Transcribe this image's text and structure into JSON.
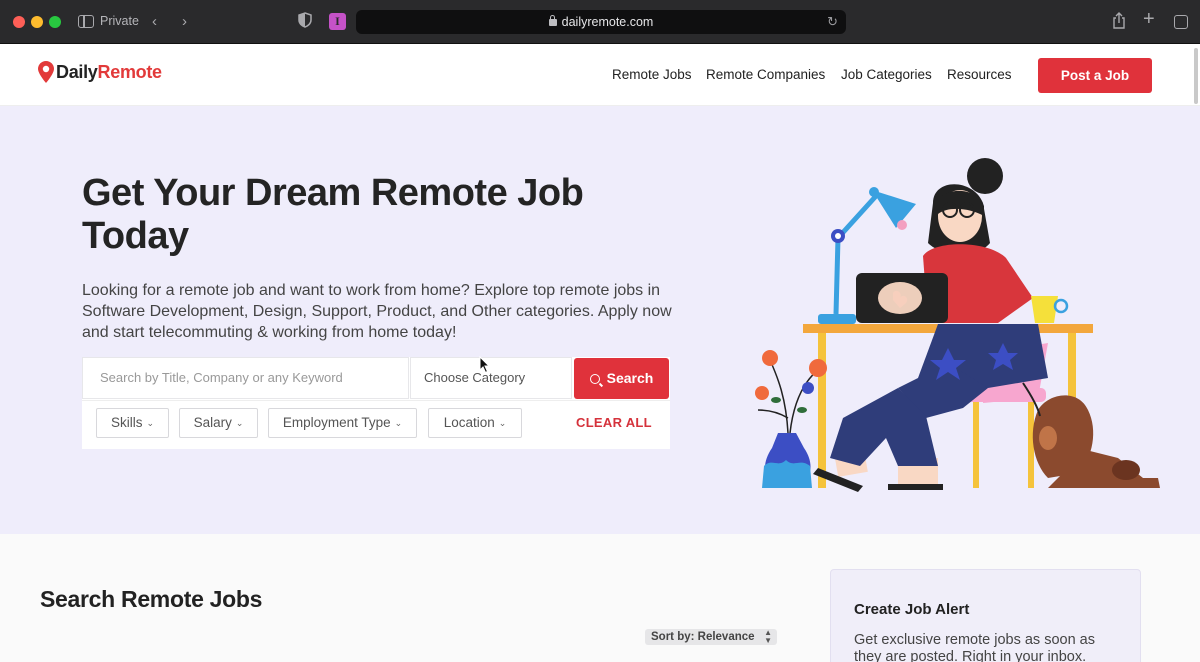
{
  "browser": {
    "private_label": "Private",
    "url": "dailyremote.com",
    "icons": [
      "sidebar-icon",
      "chevron-left-icon",
      "chevron-right-icon",
      "shield-icon",
      "extension-icon",
      "lock-icon",
      "reload-icon",
      "share-icon",
      "plus-icon",
      "tabs-icon"
    ]
  },
  "header": {
    "logo_daily": "Daily",
    "logo_remote": "Remote",
    "nav": [
      "Remote Jobs",
      "Remote Companies",
      "Job Categories",
      "Resources"
    ],
    "post_button": "Post a Job"
  },
  "hero": {
    "title": "Get Your Dream Remote Job Today",
    "description": "Looking for a remote job and want to work from home? Explore top remote jobs in Software Development, Design, Support, Product, and Other categories. Apply now and start telecommuting & working from home today!",
    "search": {
      "placeholder": "Search by Title, Company or any Keyword",
      "category_label": "Choose Category",
      "button_label": "Search"
    },
    "filters": [
      "Skills",
      "Salary",
      "Employment Type",
      "Location"
    ],
    "clear_all": "CLEAR ALL"
  },
  "jobs": {
    "section_title": "Search Remote Jobs",
    "sort_label": "Sort by: Relevance"
  },
  "alert": {
    "title": "Create Job Alert",
    "description": "Get exclusive remote jobs as soon as they are posted. Right in your inbox."
  },
  "colors": {
    "brand_red": "#e0323b",
    "hero_bg": "#efedfb"
  }
}
